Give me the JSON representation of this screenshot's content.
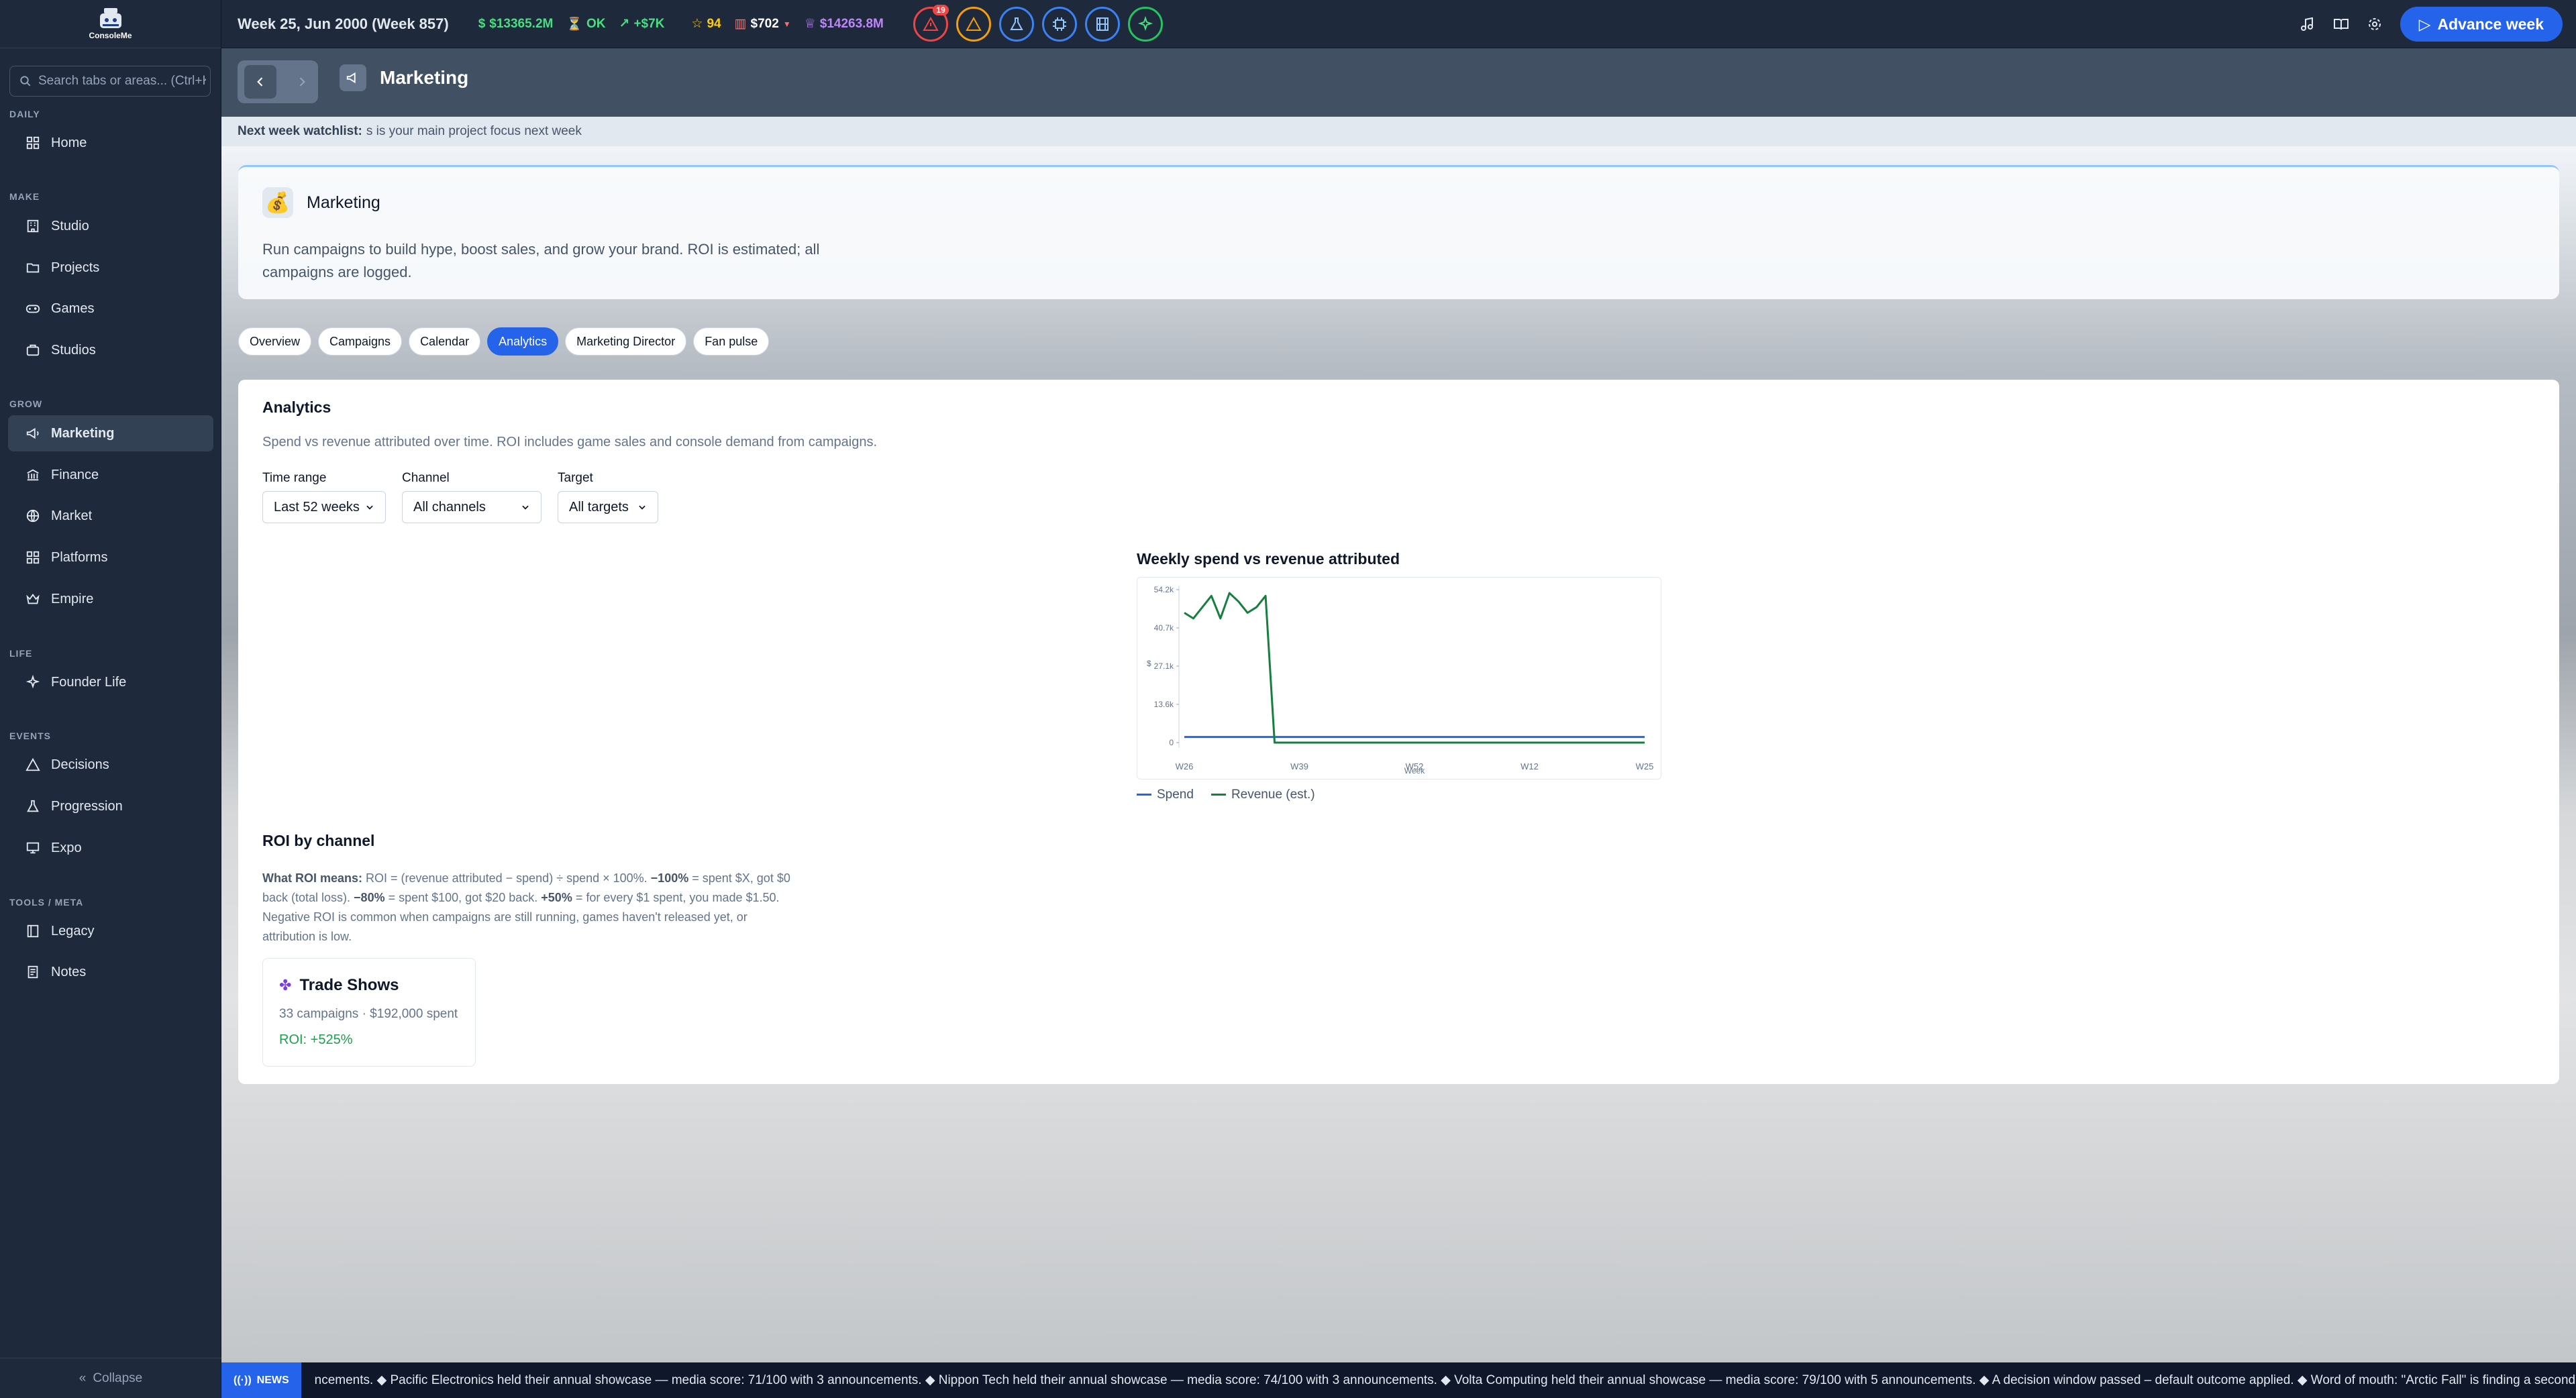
{
  "app": {
    "logo_text": "ConsoleMe"
  },
  "topbar": {
    "week": "Week 25, Jun 2000 (Week 857)",
    "cash": "$13365.2M",
    "status": "OK",
    "trend": "+$7K",
    "rating": "94",
    "price": "$702",
    "valuation": "$14263.8M",
    "alert_count": "19",
    "advance_label": "Advance week",
    "colors": {
      "cash": "#4ade80",
      "rating": "#facc15",
      "valuation": "#c084fc",
      "accent": "#2563eb"
    }
  },
  "sidebar": {
    "search_placeholder": "Search tabs or areas... (Ctrl+K)",
    "sections": {
      "daily": "DAILY",
      "make": "MAKE",
      "grow": "GROW",
      "life": "LIFE",
      "events": "EVENTS",
      "tools": "TOOLS / META"
    },
    "items": {
      "home": "Home",
      "studio": "Studio",
      "projects": "Projects",
      "games": "Games",
      "studios": "Studios",
      "marketing": "Marketing",
      "finance": "Finance",
      "market": "Market",
      "platforms": "Platforms",
      "empire": "Empire",
      "founder": "Founder Life",
      "decisions": "Decisions",
      "progression": "Progression",
      "expo": "Expo",
      "legacy": "Legacy",
      "notes": "Notes"
    },
    "collapse": "Collapse"
  },
  "header": {
    "title": "Marketing"
  },
  "watchlist": {
    "label": "Next week watchlist:",
    "text": "s is your main project focus next week"
  },
  "intro": {
    "title": "Marketing",
    "description": "Run campaigns to build hype, boost sales, and grow your brand. ROI is estimated; all campaigns are logged."
  },
  "tabs": [
    "Overview",
    "Campaigns",
    "Calendar",
    "Analytics",
    "Marketing Director",
    "Fan pulse"
  ],
  "analytics": {
    "title": "Analytics",
    "subtitle": "Spend vs revenue attributed over time. ROI includes game sales and console demand from campaigns.",
    "filters": {
      "time_label": "Time range",
      "time_value": "Last 52 weeks",
      "channel_label": "Channel",
      "channel_value": "All channels",
      "target_label": "Target",
      "target_value": "All targets"
    }
  },
  "chart_data": {
    "type": "line",
    "title": "Weekly spend vs revenue attributed",
    "xlabel": "Week",
    "ylabel": "$",
    "yticks": [
      "0",
      "13.6k",
      "27.1k",
      "40.7k",
      "54.2k"
    ],
    "ylim": [
      0,
      54200
    ],
    "xticks": [
      "W26",
      "W39",
      "W52",
      "W12",
      "W25"
    ],
    "x_count": 52,
    "series": [
      {
        "name": "Spend",
        "color": "#2563eb",
        "values": [
          2000,
          2000,
          2000,
          2000,
          2000,
          2000,
          2000,
          2000,
          2000,
          2000,
          2000,
          2000,
          2000,
          2000,
          2000,
          2000,
          2000,
          2000,
          2000,
          2000,
          2000,
          2000,
          2000,
          2000,
          2000,
          2000,
          2000,
          2000,
          2000,
          2000,
          2000,
          2000,
          2000,
          2000,
          2000,
          2000,
          2000,
          2000,
          2000,
          2000,
          2000,
          2000,
          2000,
          2000,
          2000,
          2000,
          2000,
          2000,
          2000,
          2000,
          2000,
          2000
        ]
      },
      {
        "name": "Revenue (est.)",
        "color": "#15803d",
        "values": [
          46000,
          44000,
          48000,
          52000,
          44000,
          53000,
          50000,
          46000,
          48000,
          52000,
          0,
          0,
          0,
          0,
          0,
          0,
          0,
          0,
          0,
          0,
          0,
          0,
          0,
          0,
          0,
          0,
          0,
          0,
          0,
          0,
          0,
          0,
          0,
          0,
          0,
          0,
          0,
          0,
          0,
          0,
          0,
          0,
          0,
          0,
          0,
          0,
          0,
          0,
          0,
          0,
          0,
          0
        ]
      }
    ],
    "legend": "bottom-left",
    "grid": false
  },
  "roi": {
    "title": "ROI by channel",
    "explain_label": "What ROI means:",
    "explain_text": " ROI = (revenue attributed − spend) ÷ spend × 100%. ",
    "ex1_b": "−100%",
    "ex1": " = spent $X, got $0 back (total loss). ",
    "ex2_b": "−80%",
    "ex2": " = spent $100, got $20 back. ",
    "ex3_b": "+50%",
    "ex3": " = for every $1 spent, you made $1.50. Negative ROI is common when campaigns are still running, games haven't released yet, or attribution is low.",
    "card": {
      "name": "Trade Shows",
      "stats": "33 campaigns · $192,000 spent",
      "roi": "ROI: +525%"
    }
  },
  "news": {
    "label": "NEWS",
    "text": "ncements. ◆ Pacific Electronics held their annual showcase — media score: 71/100 with 3 announcements. ◆ Nippon Tech held their annual showcase — media score: 74/100 with 3 announcements. ◆ Volta Computing held their annual showcase — media score: 79/100 with 5 announcements. ◆ A decision window passed – default outcome applied. ◆ Word of mouth: \"Arctic Fall\" is finding a second"
  }
}
